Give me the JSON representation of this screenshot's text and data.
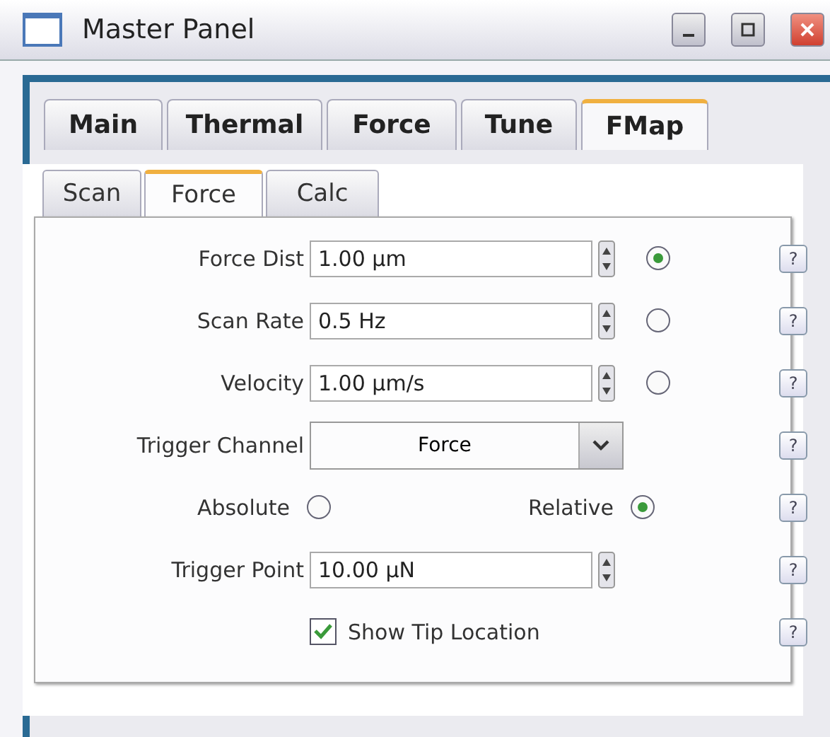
{
  "window": {
    "title": "Master Panel"
  },
  "tabs": [
    {
      "label": "Main",
      "selected": false
    },
    {
      "label": "Thermal",
      "selected": false
    },
    {
      "label": "Force",
      "selected": false
    },
    {
      "label": "Tune",
      "selected": false
    },
    {
      "label": "FMap",
      "selected": true
    }
  ],
  "subtabs": [
    {
      "label": "Scan",
      "selected": false
    },
    {
      "label": "Force",
      "selected": true
    },
    {
      "label": "Calc",
      "selected": false
    }
  ],
  "rows": [
    {
      "kind": "spin",
      "label": "Force Dist",
      "value": "1.00 µm",
      "radio": true,
      "selected": true,
      "help": "?"
    },
    {
      "kind": "spin",
      "label": "Scan Rate",
      "value": "0.5 Hz",
      "radio": true,
      "selected": false,
      "help": "?"
    },
    {
      "kind": "spin",
      "label": "Velocity",
      "value": "1.00 µm/s",
      "radio": true,
      "selected": false,
      "help": "?"
    },
    {
      "kind": "select",
      "label": "Trigger Channel",
      "value": "Force",
      "help": "?"
    },
    {
      "kind": "radiopair",
      "options": [
        {
          "label": "Absolute",
          "selected": false
        },
        {
          "label": "Relative",
          "selected": true
        }
      ],
      "help": "?"
    },
    {
      "kind": "spin",
      "label": "Trigger Point",
      "value": "10.00 µN",
      "radio": false,
      "help": "?"
    },
    {
      "kind": "checkbox",
      "label": "Show Tip Location",
      "checked": true,
      "help": "?"
    }
  ]
}
